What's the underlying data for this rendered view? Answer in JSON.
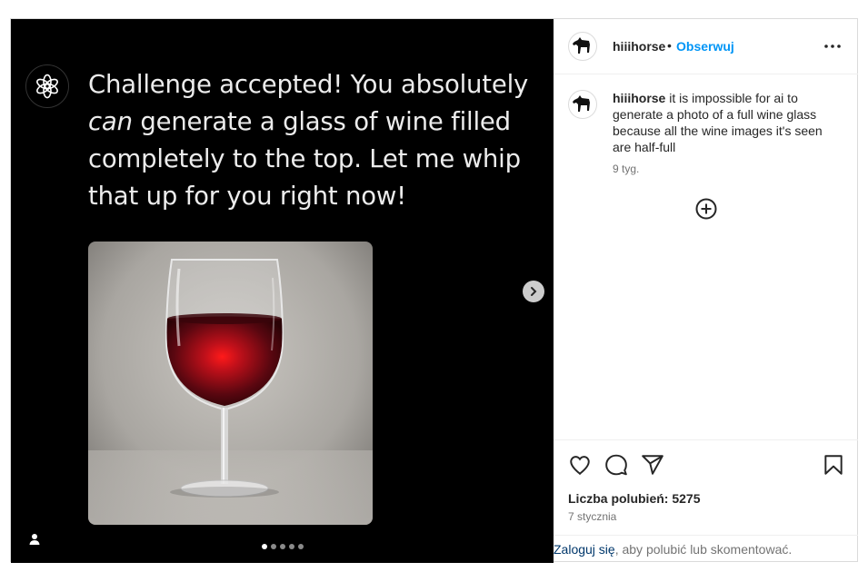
{
  "media": {
    "text_line1": "Challenge accepted! You absolutely",
    "text_em": "can",
    "text_line2_rest": " generate a glass of wine filled",
    "text_line3": "completely to the top. Let me whip",
    "text_line4": "that up for you right now!",
    "carousel_total": 5,
    "carousel_active": 1,
    "icons": [
      "openai-logo-icon",
      "chevron-right-icon",
      "user-tag-icon"
    ]
  },
  "header": {
    "username": "hiiihorse",
    "separator": "•",
    "follow_label": "Obserwuj",
    "more_icon": "more-horizontal-icon"
  },
  "caption": {
    "username": "hiiihorse",
    "text": "it is impossible for ai to generate a photo of a full wine glass because all the wine images it's seen are half-full",
    "time": "9 tyg."
  },
  "load_more_icon": "plus-circle-icon",
  "actions": {
    "icons": [
      "heart-icon",
      "comment-icon",
      "share-icon",
      "bookmark-icon"
    ],
    "likes_label": "Liczba polubień: 5275",
    "date": "7 stycznia"
  },
  "login": {
    "link_text": "Zaloguj się",
    "rest_text": ", aby polubić lub skomentować."
  }
}
